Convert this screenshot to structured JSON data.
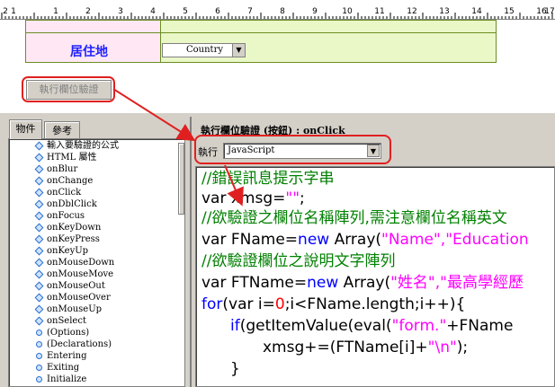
{
  "ruler": {
    "numbers": [
      "2",
      "1",
      "1",
      "2",
      "3",
      "4",
      "5",
      "6",
      "7",
      "8",
      "9",
      "10",
      "11",
      "12",
      "13",
      "14",
      "15",
      "16",
      "17"
    ]
  },
  "form": {
    "residence_label": "居住地",
    "country_value": "Country"
  },
  "validate_button": "執行欄位驗證",
  "left_panel": {
    "tab_objects": "物件",
    "tab_reference": "參考",
    "tree_items": [
      {
        "label": "輸入要驗證的公式",
        "icon": "diamond-icon"
      },
      {
        "label": "HTML 屬性",
        "icon": "diamond-icon"
      },
      {
        "label": "onBlur",
        "icon": "diamond-icon"
      },
      {
        "label": "onChange",
        "icon": "diamond-icon"
      },
      {
        "label": "onClick",
        "icon": "diamond-icon"
      },
      {
        "label": "onDblClick",
        "icon": "diamond-icon"
      },
      {
        "label": "onFocus",
        "icon": "diamond-icon"
      },
      {
        "label": "onKeyDown",
        "icon": "diamond-icon"
      },
      {
        "label": "onKeyPress",
        "icon": "diamond-icon"
      },
      {
        "label": "onKeyUp",
        "icon": "diamond-icon"
      },
      {
        "label": "onMouseDown",
        "icon": "diamond-icon"
      },
      {
        "label": "onMouseMove",
        "icon": "diamond-icon"
      },
      {
        "label": "onMouseOut",
        "icon": "diamond-icon"
      },
      {
        "label": "onMouseOver",
        "icon": "diamond-icon"
      },
      {
        "label": "onMouseUp",
        "icon": "diamond-icon"
      },
      {
        "label": "onSelect",
        "icon": "diamond-icon"
      },
      {
        "label": "(Options)",
        "icon": "circle-icon"
      },
      {
        "label": "(Declarations)",
        "icon": "circle-icon"
      },
      {
        "label": "Entering",
        "icon": "circle-icon"
      },
      {
        "label": "Exiting",
        "icon": "circle-icon"
      },
      {
        "label": "Initialize",
        "icon": "circle-icon"
      }
    ]
  },
  "right_panel": {
    "title": "執行欄位驗證 (按鈕) : onClick",
    "run_label": "執行",
    "language": "JavaScript"
  },
  "code": {
    "line1": "//錯誤訊息提示字串",
    "line2_a": "var xmsg=",
    "line2_b": "\"\"",
    "line2_c": ";",
    "line3": "//欲驗證之欄位名稱陣列,需注意欄位名稱英文",
    "line4_a": "var FName=",
    "line4_b": "new",
    "line4_c": " Array(",
    "line4_d": "\"Name\",\"Education",
    "line5": "//欲驗證欄位之說明文字陣列",
    "line6_a": "var FTName=",
    "line6_b": "new",
    "line6_c": " Array(",
    "line6_d": "\"姓名\",\"最高學經歷",
    "line7_a": "for",
    "line7_b": "(var i=",
    "line7_c": "0",
    "line7_d": ";i<FName.length;i++){",
    "line8_a": "if",
    "line8_b": "(getItemValue(eval(",
    "line8_c": "\"form.\"",
    "line8_d": "+FName",
    "line9_a": "xmsg+=(FTName[i]+",
    "line9_b": "\"\\n\"",
    "line9_c": ");",
    "line10": "}"
  },
  "colors": {
    "annotation": "#e02020",
    "comment": "#008000",
    "keyword": "#0000ff",
    "string": "#ff00ff"
  }
}
